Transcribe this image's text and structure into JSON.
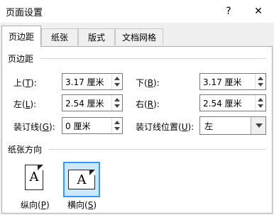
{
  "window": {
    "title": "页面设置",
    "help": "?",
    "close": "✕"
  },
  "tabs": [
    {
      "label": "页边距",
      "active": true
    },
    {
      "label": "纸张"
    },
    {
      "label": "版式"
    },
    {
      "label": "文档网格"
    }
  ],
  "margins": {
    "group_title": "页边距",
    "top": {
      "label_prefix": "上(",
      "accel": "T",
      "label_suffix": "):",
      "value": "3.17 厘米"
    },
    "bottom": {
      "label_prefix": "下(",
      "accel": "B",
      "label_suffix": "):",
      "value": "3.17 厘米"
    },
    "left": {
      "label_prefix": "左(",
      "accel": "L",
      "label_suffix": "):",
      "value": "2.54 厘米"
    },
    "right": {
      "label_prefix": "右(",
      "accel": "R",
      "label_suffix": "):",
      "value": "2.54 厘米"
    },
    "gutter": {
      "label_prefix": "装订线(",
      "accel": "G",
      "label_suffix": "):",
      "value": "0 厘米"
    },
    "gutter_pos": {
      "label_prefix": "装订线位置(",
      "accel": "U",
      "label_suffix": "):",
      "value": "左"
    }
  },
  "orientation": {
    "group_title": "纸张方向",
    "portrait": {
      "label_prefix": "纵向(",
      "accel": "P",
      "label_suffix": ")",
      "glyph": "A",
      "selected": false
    },
    "landscape": {
      "label_prefix": "横向(",
      "accel": "S",
      "label_suffix": ")",
      "glyph": "A",
      "selected": true
    }
  },
  "colors": {
    "selection_border": "#3399ff",
    "selection_fill": "#cce8ff"
  }
}
